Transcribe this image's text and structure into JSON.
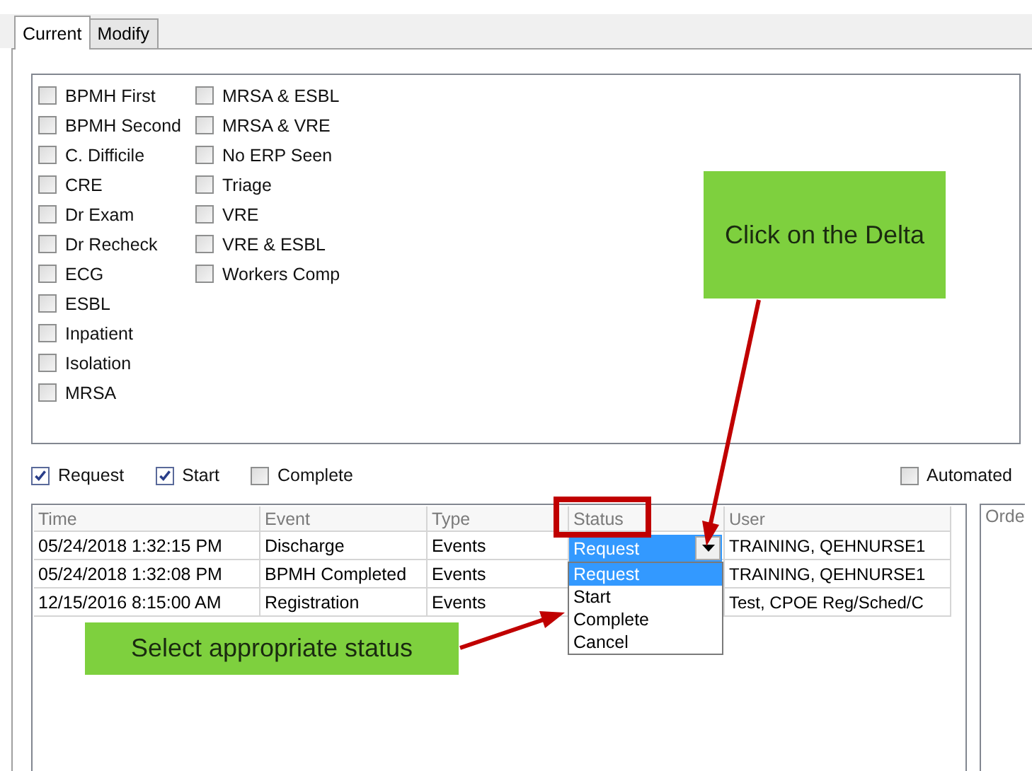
{
  "tabs": [
    {
      "label": "Current",
      "selected": true
    },
    {
      "label": "Modify",
      "selected": false
    }
  ],
  "flags": [
    [
      {
        "label": "BPMH First",
        "checked": false
      },
      {
        "label": "BPMH Second",
        "checked": false
      },
      {
        "label": "C. Difficile",
        "checked": false
      },
      {
        "label": "CRE",
        "checked": false
      },
      {
        "label": "Dr Exam",
        "checked": false
      },
      {
        "label": "Dr Recheck",
        "checked": false
      },
      {
        "label": "ECG",
        "checked": false
      },
      {
        "label": "ESBL",
        "checked": false
      },
      {
        "label": "Inpatient",
        "checked": false
      },
      {
        "label": "Isolation",
        "checked": false
      },
      {
        "label": "MRSA",
        "checked": false
      }
    ],
    [
      {
        "label": "MRSA & ESBL",
        "checked": false
      },
      {
        "label": "MRSA & VRE",
        "checked": false
      },
      {
        "label": "No ERP Seen",
        "checked": false
      },
      {
        "label": "Triage",
        "checked": false
      },
      {
        "label": "VRE",
        "checked": false
      },
      {
        "label": "VRE & ESBL",
        "checked": false
      },
      {
        "label": "Workers Comp",
        "checked": false
      }
    ]
  ],
  "filters": [
    {
      "label": "Request",
      "checked": true
    },
    {
      "label": "Start",
      "checked": true
    },
    {
      "label": "Complete",
      "checked": false
    }
  ],
  "automated": {
    "label": "Automated",
    "checked": false
  },
  "table": {
    "columns": [
      "Time",
      "Event",
      "Type",
      "Status",
      "User"
    ],
    "rows": [
      {
        "time": "05/24/2018 1:32:15 PM",
        "event": "Discharge",
        "type": "Events",
        "user": "TRAINING, QEHNURSE1"
      },
      {
        "time": "05/24/2018 1:32:08 PM",
        "event": "BPMH Completed",
        "type": "Events",
        "user": "TRAINING, QEHNURSE1"
      },
      {
        "time": "12/15/2016 8:15:00 AM",
        "event": "Registration",
        "type": "Events",
        "user": "Test, CPOE Reg/Sched/C"
      }
    ]
  },
  "status_dropdown": {
    "value": "Request",
    "options": [
      {
        "label": "Request",
        "selected": true
      },
      {
        "label": "Start",
        "selected": false
      },
      {
        "label": "Complete",
        "selected": false
      },
      {
        "label": "Cancel",
        "selected": false
      }
    ]
  },
  "side_panel": {
    "title": "Orde"
  },
  "callouts": [
    {
      "text": "Click on the Delta"
    },
    {
      "text": "Select appropriate status"
    }
  ]
}
